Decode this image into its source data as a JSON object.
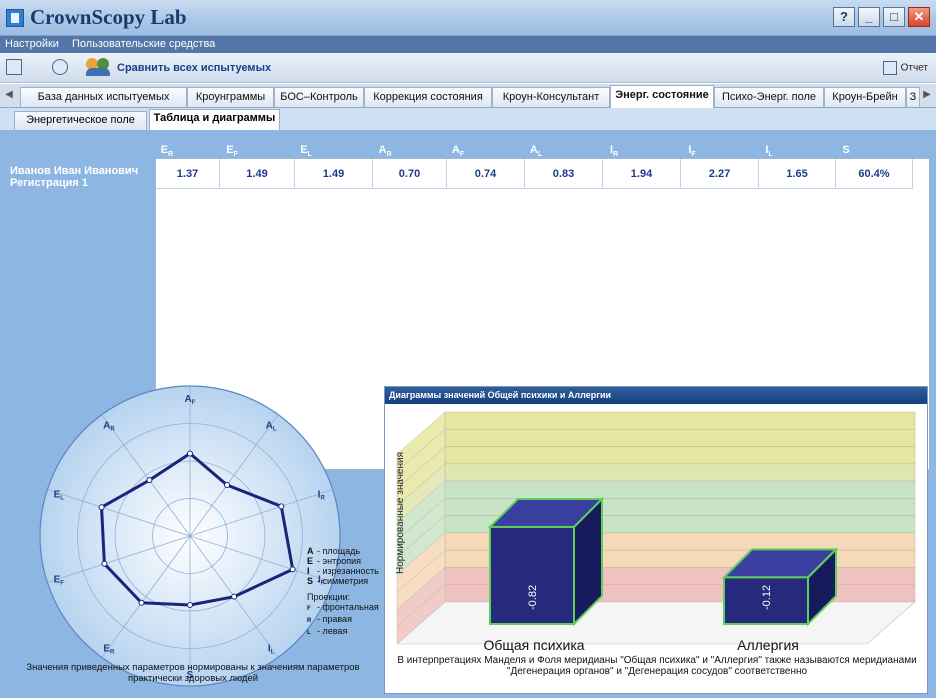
{
  "app": {
    "title": "CrownScopy Lab",
    "window_buttons": [
      "?",
      "_",
      "□",
      "✕"
    ]
  },
  "menu": [
    "Настройки",
    "Пользовательские средства"
  ],
  "toolbar": {
    "compare_label": "Сравнить всех испытуемых",
    "report_label": "Отчет"
  },
  "main_tabs": [
    {
      "label": "База данных испытуемых"
    },
    {
      "label": "Кроунграммы"
    },
    {
      "label": "БОС–Контроль"
    },
    {
      "label": "Коррекция состояния"
    },
    {
      "label": "Кроун-Консультант"
    },
    {
      "label": "Энерг. состояние",
      "active": true
    },
    {
      "label": "Психо-Энерг. поле"
    },
    {
      "label": "Кроун-Брейн"
    },
    {
      "label": "З"
    }
  ],
  "sub_tabs": [
    {
      "label": "Энергетическое поле"
    },
    {
      "label": "Таблица и диаграммы",
      "active": true
    }
  ],
  "table": {
    "columns": [
      {
        "main": "E",
        "sub": "R"
      },
      {
        "main": "E",
        "sub": "F"
      },
      {
        "main": "E",
        "sub": "L"
      },
      {
        "main": "A",
        "sub": "R"
      },
      {
        "main": "A",
        "sub": "F"
      },
      {
        "main": "A",
        "sub": "L"
      },
      {
        "main": "I",
        "sub": "R"
      },
      {
        "main": "I",
        "sub": "F"
      },
      {
        "main": "I",
        "sub": "L"
      },
      {
        "main": "S",
        "sub": ""
      }
    ],
    "rows": [
      {
        "name": "Иванов Иван Иванович Регистрация 1",
        "values": [
          "1.37",
          "1.49",
          "1.49",
          "0.70",
          "0.74",
          "0.83",
          "1.94",
          "2.27",
          "1.65",
          "60.4%"
        ]
      }
    ]
  },
  "radar": {
    "axes": [
      {
        "main": "A",
        "sub": "F"
      },
      {
        "main": "A",
        "sub": "L"
      },
      {
        "main": "I",
        "sub": "R"
      },
      {
        "main": "I",
        "sub": "F"
      },
      {
        "main": "I",
        "sub": "L"
      },
      {
        "main": "S",
        "sub": ""
      },
      {
        "main": "E",
        "sub": "R"
      },
      {
        "main": "E",
        "sub": "F"
      },
      {
        "main": "E",
        "sub": "L"
      },
      {
        "main": "A",
        "sub": "R"
      }
    ],
    "values": [
      0.55,
      0.42,
      0.64,
      0.72,
      0.5,
      0.46,
      0.55,
      0.6,
      0.62,
      0.46
    ],
    "line_color": "#1c237a",
    "legend": [
      {
        "k": "A",
        "v": "- площадь"
      },
      {
        "k": "E",
        "v": "- энтропия"
      },
      {
        "k": "I",
        "v": "- изрезанность"
      },
      {
        "k": "S",
        "v": "- симметрия"
      }
    ],
    "projections_title": "Проекции:",
    "projections": [
      {
        "k": "F",
        "v": "- фронтальная"
      },
      {
        "k": "R",
        "v": "- правая"
      },
      {
        "k": "L",
        "v": "- левая"
      }
    ],
    "footnote": "Значения приведенных параметров нормированы к значениям параметров практически здоровых людей"
  },
  "chart_data": {
    "type": "bar",
    "title": "Диаграммы значений Общей психики и Аллергии",
    "categories": [
      "Общая психика",
      "Аллергия"
    ],
    "values": [
      -0.82,
      -0.12
    ],
    "value_labels": [
      "-0.82",
      "-0.12"
    ],
    "ylabel": "Нормированные значения",
    "bar_color": "#262a7c",
    "bar_edge_color": "#5fcf5a",
    "band_colors": [
      "#e7e6a0",
      "#dfe6b0",
      "#c9e3c6",
      "#f6d9b9",
      "#f0c2bf"
    ],
    "note": "В интерпретациях Манделя и Фоля меридианы \"Общая психика\" и \"Аллергия\" также называются меридианами \"Дегенерация органов\" и \"Дегенерация сосудов\" соответственно"
  },
  "colors": {
    "accent": "#1b3c8a",
    "panel_bg": "#8db6e3"
  }
}
